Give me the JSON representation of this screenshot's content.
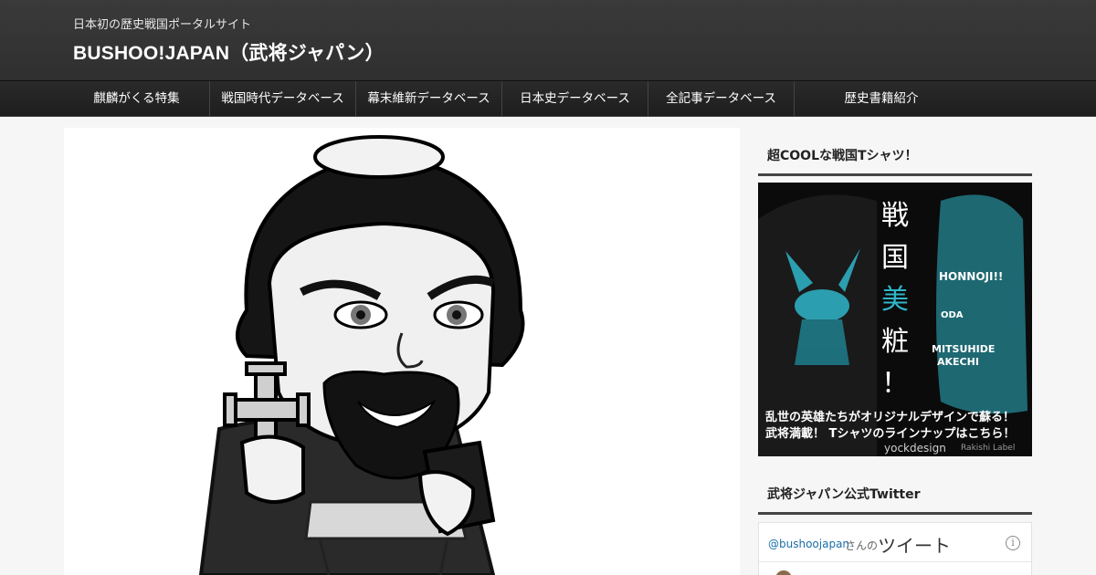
{
  "header": {
    "tagline": "日本初の歴史戦国ポータルサイト",
    "site_title": "BUSHOO!JAPAN（武将ジャパン）"
  },
  "nav": {
    "items": [
      {
        "label": "麒麟がくる特集"
      },
      {
        "label": "戦国時代データベース"
      },
      {
        "label": "幕末維新データベース"
      },
      {
        "label": "日本史データベース"
      },
      {
        "label": "全記事データベース"
      },
      {
        "label": "歴史書籍紹介"
      }
    ]
  },
  "sidebar": {
    "tshirt_widget": {
      "title": "超COOLな戦国Tシャツ！",
      "banner_vertical": [
        "戦",
        "国",
        "美",
        "粧",
        "！"
      ],
      "banner_line1": "乱世の英雄たちがオリジナルデザインで蘇る！",
      "banner_line2": "武将満載！ Tシャツのラインナップはこちら！",
      "banner_credit": "yockdesign",
      "banner_credit2": "Rakishi Label",
      "banner_words": [
        "HONNOJI!!",
        "MITSUHIDE",
        "AKECHI",
        "ODA"
      ]
    },
    "twitter_widget": {
      "title": "武将ジャパン公式Twitter",
      "handle": "@bushoojapan",
      "san": "さんの",
      "tweets_label": "ツイート",
      "info_glyph": "i"
    }
  },
  "colors": {
    "header_bg": "#333333",
    "nav_bg": "#222222",
    "banner_accent": "#2fb6c9",
    "twitter_link": "#1b6ea8"
  }
}
